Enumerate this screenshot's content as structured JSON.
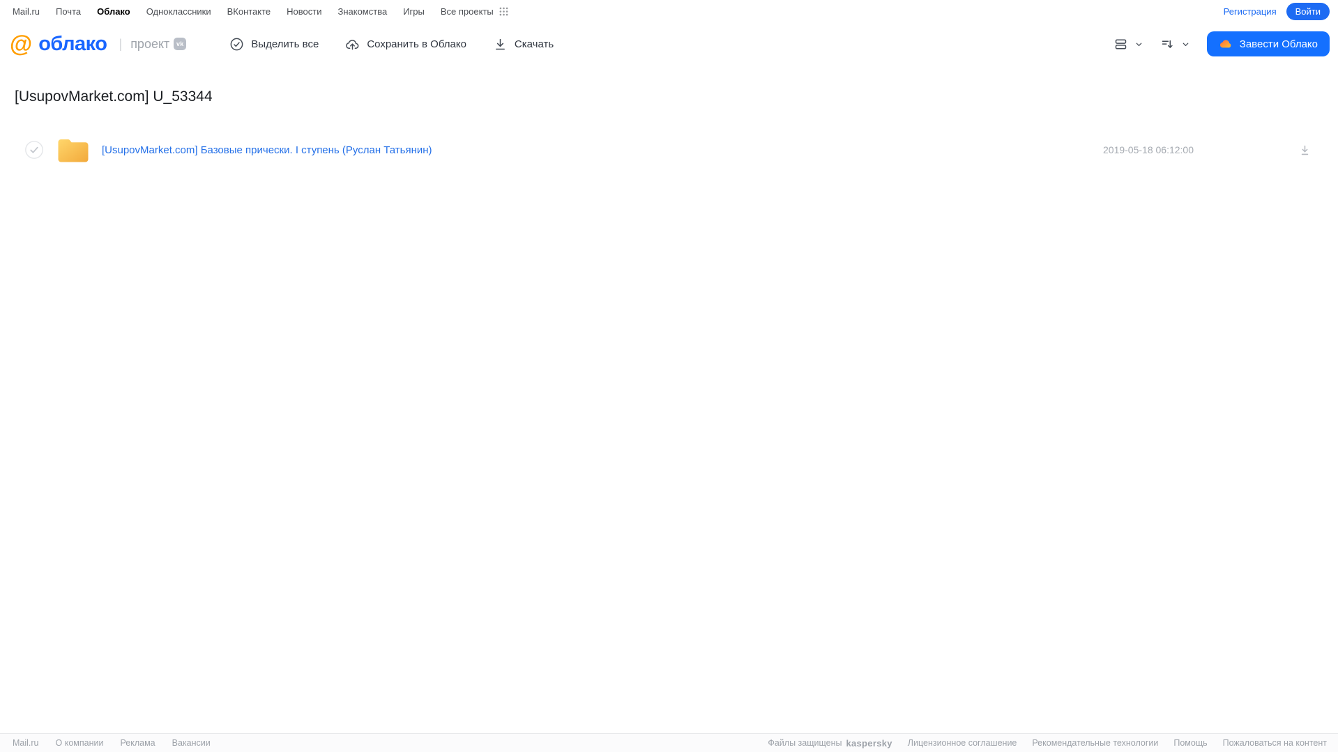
{
  "portal_nav": {
    "links": [
      {
        "label": "Mail.ru"
      },
      {
        "label": "Почта"
      },
      {
        "label": "Облако"
      },
      {
        "label": "Одноклассники"
      },
      {
        "label": "ВКонтакте"
      },
      {
        "label": "Новости"
      },
      {
        "label": "Знакомства"
      },
      {
        "label": "Игры"
      },
      {
        "label": "Все проекты"
      }
    ],
    "registration_label": "Регистрация",
    "login_label": "Войти"
  },
  "header": {
    "logo": {
      "at_symbol": "@",
      "product_name": "облако",
      "divider": "|",
      "project_label": "проект",
      "vk_badge": "vk"
    },
    "toolbar": {
      "select_all": "Выделить все",
      "save_to_cloud": "Сохранить в Облако",
      "download": "Скачать"
    },
    "get_cloud_button": "Завести Облако"
  },
  "main": {
    "title": "[UsupovMarket.com] U_53344",
    "files": [
      {
        "type": "folder",
        "name": "[UsupovMarket.com] Базовые прически. I ступень (Руслан Татьянин)",
        "modified": "2019-05-18 06:12:00"
      }
    ]
  },
  "footer": {
    "left_links": [
      "Mail.ru",
      "О компании",
      "Реклама",
      "Вакансии"
    ],
    "protected_text": "Файлы защищены",
    "kaspersky_logo": "kaspersky",
    "right_links": [
      "Лицензионное соглашение",
      "Рекомендательные технологии",
      "Помощь",
      "Пожаловаться на контент"
    ]
  },
  "icons": {
    "apps_grid": "apps-grid-icon",
    "select_all": "check-circle-icon",
    "save_cloud": "cloud-upload-icon",
    "download": "download-icon",
    "view_rows": "rows-view-icon",
    "sort": "sort-icon",
    "chevron": "chevron-down-icon",
    "cloud": "cloud-icon",
    "folder": "folder-icon",
    "checkbox": "checkbox-circle-icon"
  },
  "colors": {
    "accent_blue": "#1470ff",
    "link_blue": "#2470e8",
    "logo_orange": "#ff9e00",
    "logo_blue": "#1966ff",
    "folder_yellow_top": "#ffd66b",
    "folder_yellow_bottom": "#f2a93b",
    "kaspersky_green": "#00a88e",
    "muted_gray": "#a5aab1"
  }
}
